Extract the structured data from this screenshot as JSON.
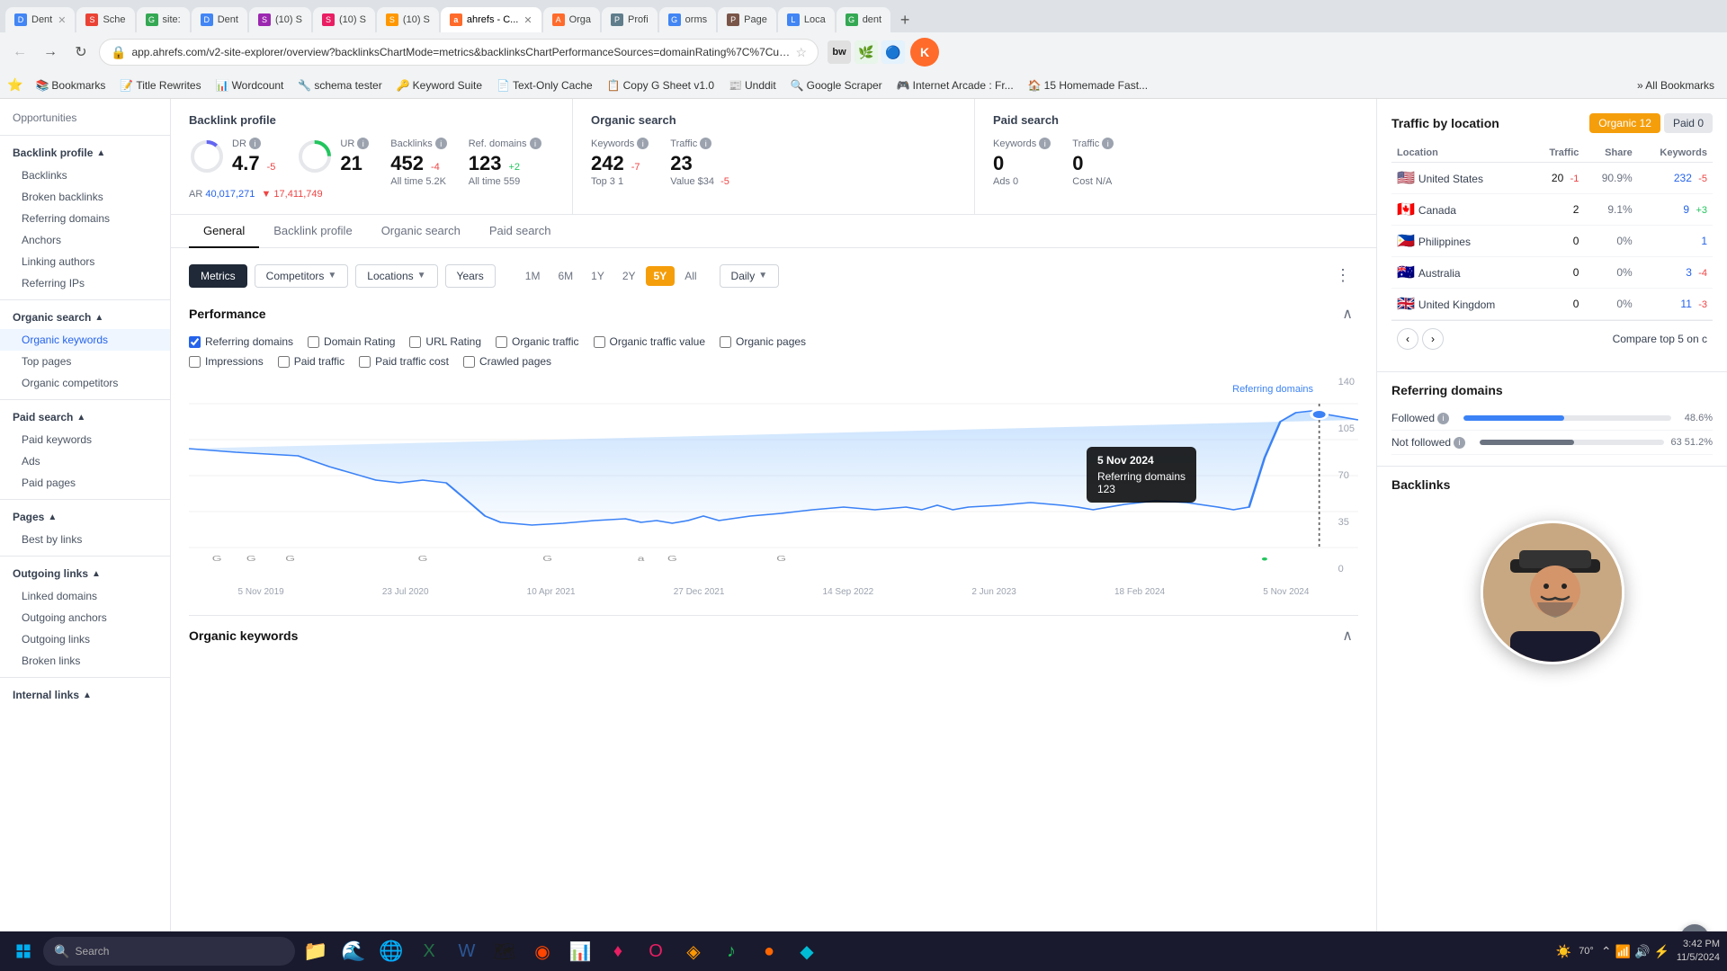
{
  "browser": {
    "url": "app.ahrefs.com/v2-site-explorer/overview?backlinksChartMode=metrics&backlinksChartPerformanceSources=domainRating%7C%7CurlRati...",
    "tabs": [
      {
        "label": "Dent",
        "favicon": "D",
        "active": false
      },
      {
        "label": "Sche",
        "favicon": "S",
        "active": false
      },
      {
        "label": "site:",
        "favicon": "G",
        "active": false
      },
      {
        "label": "Dent",
        "favicon": "D",
        "active": false
      },
      {
        "label": "(10) S",
        "favicon": "S",
        "active": false
      },
      {
        "label": "(10) S",
        "favicon": "S",
        "active": false
      },
      {
        "label": "(10) S",
        "favicon": "S",
        "active": false
      },
      {
        "label": "ahrefs",
        "favicon": "a",
        "active": true
      },
      {
        "label": "Orga",
        "favicon": "A",
        "active": false
      },
      {
        "label": "Profi",
        "favicon": "P",
        "active": false
      },
      {
        "label": "orms",
        "favicon": "G",
        "active": false
      },
      {
        "label": "Page",
        "favicon": "P",
        "active": false
      },
      {
        "label": "Loca",
        "favicon": "L",
        "active": false
      },
      {
        "label": "dent",
        "favicon": "G",
        "active": false
      }
    ],
    "bookmarks": [
      "Bookmarks",
      "Title Rewrites",
      "Wordcount",
      "schema tester",
      "Keyword Suite",
      "Text-Only Cache",
      "Copy G Sheet v1.0",
      "Unddit",
      "Google Scraper",
      "Internet Arcade : Fr...",
      "15 Homemade Fast...",
      "All Bookmarks"
    ]
  },
  "sidebar": {
    "opportunities": "Opportunities",
    "backlink_profile": "Backlink profile",
    "sections": [
      {
        "label": "Backlink profile",
        "expanded": true,
        "items": [
          "Backlinks",
          "Broken backlinks",
          "Referring domains",
          "Anchors",
          "Linking authors",
          "Referring IPs"
        ]
      },
      {
        "label": "Organic search",
        "expanded": true,
        "items": [
          "Organic keywords",
          "Top pages",
          "Organic competitors"
        ]
      },
      {
        "label": "Paid search",
        "expanded": true,
        "items": [
          "Paid keywords",
          "Ads",
          "Paid pages"
        ]
      },
      {
        "label": "Pages",
        "expanded": true,
        "items": [
          "Best by links"
        ]
      },
      {
        "label": "Outgoing links",
        "expanded": true,
        "items": [
          "Linked domains",
          "Outgoing anchors",
          "Outgoing links",
          "Broken links"
        ]
      },
      {
        "label": "Internal links",
        "expanded": true,
        "items": []
      }
    ]
  },
  "summary": {
    "backlink_profile": {
      "title": "Backlink profile",
      "dr": {
        "label": "DR",
        "value": "4.7",
        "change": "-5"
      },
      "ur": {
        "label": "UR",
        "value": "21"
      },
      "backlinks": {
        "label": "Backlinks",
        "value": "452",
        "change": "-4",
        "sub": "All time  5.2K"
      },
      "ref_domains": {
        "label": "Ref. domains",
        "value": "123",
        "change": "+2",
        "sub": "All time  559"
      },
      "ar_label": "AR",
      "ar_value": "40,017,271",
      "ar_change": "▼ 17,411,749"
    },
    "organic_search": {
      "title": "Organic search",
      "keywords": {
        "label": "Keywords",
        "value": "242",
        "change": "-7",
        "sub": "Top 3  1"
      },
      "traffic": {
        "label": "Traffic",
        "value": "23",
        "sub": "Value  $34",
        "sub_change": "-5"
      }
    },
    "paid_search": {
      "title": "Paid search",
      "keywords": {
        "label": "Keywords",
        "value": "0",
        "sub": "Ads  0"
      },
      "traffic": {
        "label": "Traffic",
        "value": "0",
        "sub": "Cost  N/A"
      }
    }
  },
  "tabs": {
    "items": [
      "General",
      "Backlink profile",
      "Organic search",
      "Paid search"
    ],
    "active": "General"
  },
  "chart_controls": {
    "filter_btns": [
      "Metrics",
      "Competitors",
      "Locations",
      "Years"
    ],
    "time_btns": [
      "1M",
      "6M",
      "1Y",
      "2Y",
      "5Y",
      "All"
    ],
    "active_time": "5Y",
    "period_type": "Daily"
  },
  "performance": {
    "title": "Performance",
    "checkboxes_row1": [
      {
        "label": "Referring domains",
        "checked": true,
        "color": "blue"
      },
      {
        "label": "Domain Rating",
        "checked": false,
        "color": "gray"
      },
      {
        "label": "URL Rating",
        "checked": false,
        "color": "gray"
      },
      {
        "label": "Organic traffic",
        "checked": false,
        "color": "yellow"
      },
      {
        "label": "Organic traffic value",
        "checked": false,
        "color": "gray"
      },
      {
        "label": "Organic pages",
        "checked": false,
        "color": "gray"
      }
    ],
    "checkboxes_row2": [
      {
        "label": "Impressions",
        "checked": false
      },
      {
        "label": "Paid traffic",
        "checked": false
      },
      {
        "label": "Paid traffic cost",
        "checked": false
      },
      {
        "label": "Crawled pages",
        "checked": false
      }
    ],
    "chart_label": "Referring domains",
    "y_labels": [
      "140",
      "105",
      "70",
      "35",
      "0"
    ],
    "x_labels": [
      "5 Nov 2019",
      "23 Jul 2020",
      "10 Apr 2021",
      "27 Dec 2021",
      "14 Sep 2022",
      "2 Jun 2023",
      "18 Feb 2024",
      "5 Nov 2024"
    ],
    "tooltip": {
      "date": "5 Nov 2024",
      "label": "Referring domains",
      "value": "123"
    }
  },
  "organic_keywords": {
    "title": "Organic keywords"
  },
  "right_panel": {
    "traffic_by_location": {
      "title": "Traffic by location",
      "tabs": [
        {
          "label": "Organic",
          "count": "12",
          "active": true
        },
        {
          "label": "Paid",
          "count": "0",
          "active": false
        }
      ],
      "columns": [
        "Location",
        "Traffic",
        "Share",
        "Keywords"
      ],
      "rows": [
        {
          "flag": "🇺🇸",
          "country": "United States",
          "traffic": "20",
          "traffic_change": "-1",
          "share": "90.9%",
          "keywords": "232",
          "kw_change": "-5"
        },
        {
          "flag": "🇨🇦",
          "country": "Canada",
          "traffic": "2",
          "traffic_change": "",
          "share": "9.1%",
          "keywords": "9",
          "kw_change": "+3"
        },
        {
          "flag": "🇵🇭",
          "country": "Philippines",
          "traffic": "0",
          "traffic_change": "",
          "share": "0%",
          "keywords": "1",
          "kw_change": ""
        },
        {
          "flag": "🇦🇺",
          "country": "Australia",
          "traffic": "0",
          "traffic_change": "",
          "share": "0%",
          "keywords": "3",
          "kw_change": "-4"
        },
        {
          "flag": "🇬🇧",
          "country": "United Kingdom",
          "traffic": "0",
          "traffic_change": "",
          "share": "0%",
          "keywords": "11",
          "kw_change": "-3"
        }
      ],
      "compare_text": "Compare top 5 on c"
    },
    "referring_domains": {
      "title": "Referring domains",
      "items": [
        {
          "label": "Followed",
          "value": "",
          "percent": "48.6%",
          "bar": 48.6
        },
        {
          "label": "Not followed",
          "value": "63",
          "percent": "51.2%",
          "bar": 51.2
        }
      ]
    },
    "backlinks_title": "Backlinks"
  },
  "taskbar": {
    "search_placeholder": "Search",
    "time": "3:42 PM",
    "date": "11/5/2024",
    "temp": "70°"
  }
}
